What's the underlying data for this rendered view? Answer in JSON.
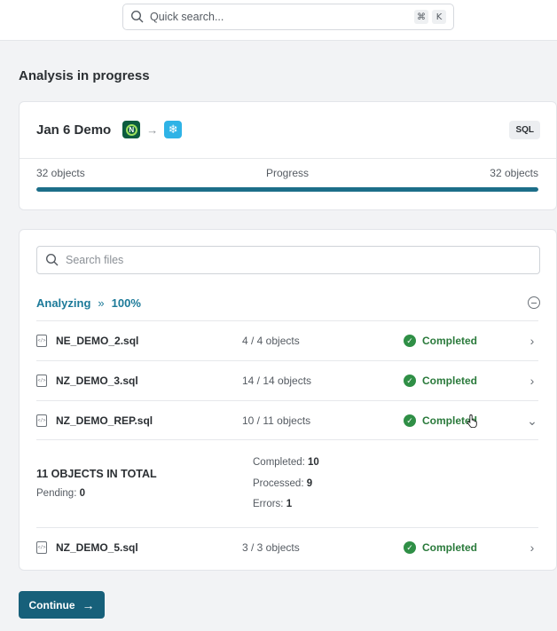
{
  "search": {
    "placeholder": "Quick search...",
    "shortcut_mod": "⌘",
    "shortcut_key": "K"
  },
  "page": {
    "title": "Analysis in progress"
  },
  "project": {
    "name": "Jan 6 Demo",
    "source_logo_letter": "N",
    "arrow": "→",
    "badge": "SQL",
    "left_count": "32 objects",
    "progress_label": "Progress",
    "right_count": "32 objects",
    "progress_fraction": 1.0,
    "accent_color": "#1c6e89"
  },
  "files": {
    "search_placeholder": "Search files",
    "analyzing_label": "Analyzing",
    "analyzing_chevron": "»",
    "analyzing_percent": "100%",
    "rows": [
      {
        "icon_text": "</>",
        "name": "NE_DEMO_2.sql",
        "objects": "4 / 4 objects",
        "status": "Completed",
        "chevron": "›"
      },
      {
        "icon_text": "</>",
        "name": "NZ_DEMO_3.sql",
        "objects": "14 / 14 objects",
        "status": "Completed",
        "chevron": "›"
      },
      {
        "icon_text": "</>",
        "name": "NZ_DEMO_REP.sql",
        "objects": "10 / 11 objects",
        "status": "Completed",
        "chevron": "⌄"
      },
      {
        "icon_text": "</>",
        "name": "NZ_DEMO_5.sql",
        "objects": "3 / 3 objects",
        "status": "Completed",
        "chevron": "›"
      }
    ],
    "details": {
      "total_title": "11 OBJECTS IN TOTAL",
      "pending_label": "Pending:",
      "pending_value": "0",
      "completed_label": "Completed:",
      "completed_value": "10",
      "processed_label": "Processed:",
      "processed_value": "9",
      "errors_label": "Errors:",
      "errors_value": "1"
    },
    "status_color": "#2a7a3b"
  },
  "actions": {
    "continue_label": "Continue",
    "continue_arrow": "→"
  }
}
